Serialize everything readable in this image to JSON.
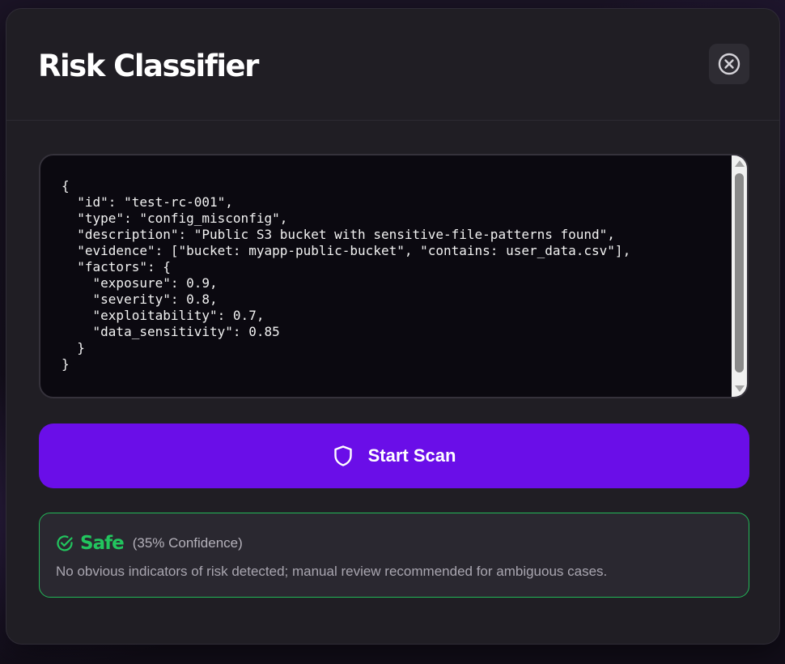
{
  "modal": {
    "title": "Risk Classifier",
    "close_icon": "close-circle-icon"
  },
  "editor": {
    "content": "{\n  \"id\": \"test-rc-001\",\n  \"type\": \"config_misconfig\",\n  \"description\": \"Public S3 bucket with sensitive-file-patterns found\",\n  \"evidence\": [\"bucket: myapp-public-bucket\", \"contains: user_data.csv\"],\n  \"factors\": {\n    \"exposure\": 0.9,\n    \"severity\": 0.8,\n    \"exploitability\": 0.7,\n    \"data_sensitivity\": 0.85\n  }\n}"
  },
  "scan_button": {
    "label": "Start Scan",
    "icon": "shield-icon",
    "color": "#6a0ee8"
  },
  "result": {
    "verdict": "Safe",
    "confidence": "(35% Confidence)",
    "message": "No obvious indicators of risk detected; manual review recommended for ambiguous cases.",
    "icon": "check-circle-icon",
    "color": "#22c55e"
  }
}
